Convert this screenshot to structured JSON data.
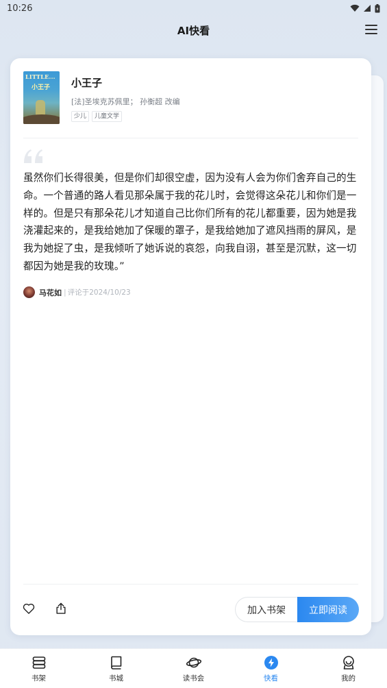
{
  "status_bar": {
    "time": "10:26"
  },
  "header": {
    "title": "AI快看"
  },
  "book": {
    "title": "小王子",
    "author": "[法]圣埃克苏佩里； 孙衡超 改编",
    "tags": [
      "少儿",
      "儿童文学"
    ],
    "cover": {
      "title_en": "LITTLE...",
      "title_cn": "小王子"
    }
  },
  "quote": {
    "text": "虽然你们长得很美，但是你们却很空虚，因为没有人会为你们舍弃自己的生命。一个普通的路人看见那朵属于我的花儿时，会觉得这朵花儿和你们是一样的。但是只有那朵花儿才知道自己比你们所有的花儿都重要，因为她是我浇灌起来的，是我给她加了保暖的罩子，是我给她加了遮风挡雨的屏风，是我为她捉了虫，是我倾听了她诉说的哀怨，向我自诩，甚至是沉默，这一切都因为她是我的玫瑰。”"
  },
  "reviewer": {
    "name": "马花如",
    "separator": "|",
    "date": "评论于2024/10/23"
  },
  "actions": {
    "add_shelf": "加入书架",
    "read_now": "立即阅读"
  },
  "tabs": [
    {
      "label": "书架",
      "icon": "bookshelf-icon"
    },
    {
      "label": "书城",
      "icon": "book-icon"
    },
    {
      "label": "读书会",
      "icon": "planet-icon"
    },
    {
      "label": "快看",
      "icon": "lightning-icon",
      "active": true
    },
    {
      "label": "我的",
      "icon": "profile-icon"
    }
  ],
  "colors": {
    "accent": "#2b88f0",
    "background": "#dde6f1"
  }
}
